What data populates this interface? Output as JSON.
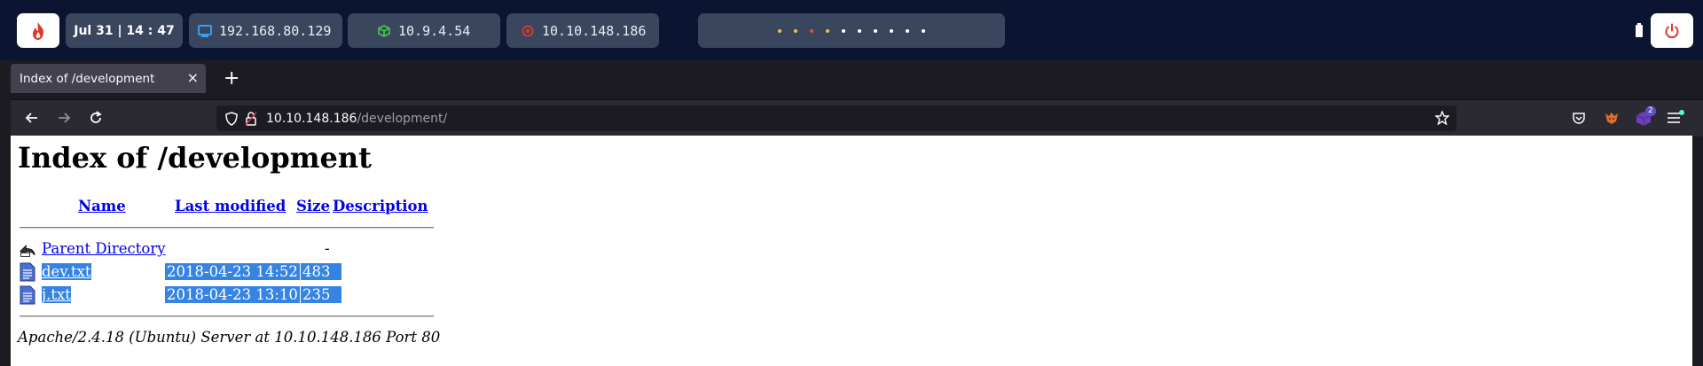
{
  "topbar": {
    "datetime": "Jul 31 | 14 : 47",
    "ip_local": "192.168.80.129",
    "ip_vpn": "10.9.4.54",
    "ip_target": "10.10.148.186",
    "workspace_dot_colors": [
      "#f4c430",
      "#f4c430",
      "#e05a2a",
      "#f4c430",
      "#ffffff",
      "#ffffff",
      "#ffffff",
      "#ffffff",
      "#ffffff",
      "#ffffff"
    ]
  },
  "browser": {
    "tab_title": "Index of /development",
    "url_host": "10.10.148.186",
    "url_path": "/development/",
    "extension_badge": "2"
  },
  "page": {
    "heading": "Index of /development",
    "columns": {
      "name": "Name",
      "last_modified": "Last modified",
      "size": "Size",
      "description": "Description"
    },
    "rows": [
      {
        "name": "Parent Directory",
        "last_modified": "",
        "size": "-",
        "description": "",
        "icon": "back-icon"
      },
      {
        "name": "dev.txt",
        "last_modified": "2018-04-23 14:52",
        "size": "483",
        "description": "",
        "icon": "text-file-icon"
      },
      {
        "name": "j.txt",
        "last_modified": "2018-04-23 13:10",
        "size": "235",
        "description": "",
        "icon": "text-file-icon"
      }
    ],
    "footer": "Apache/2.4.18 (Ubuntu) Server at 10.10.148.186 Port 80"
  }
}
